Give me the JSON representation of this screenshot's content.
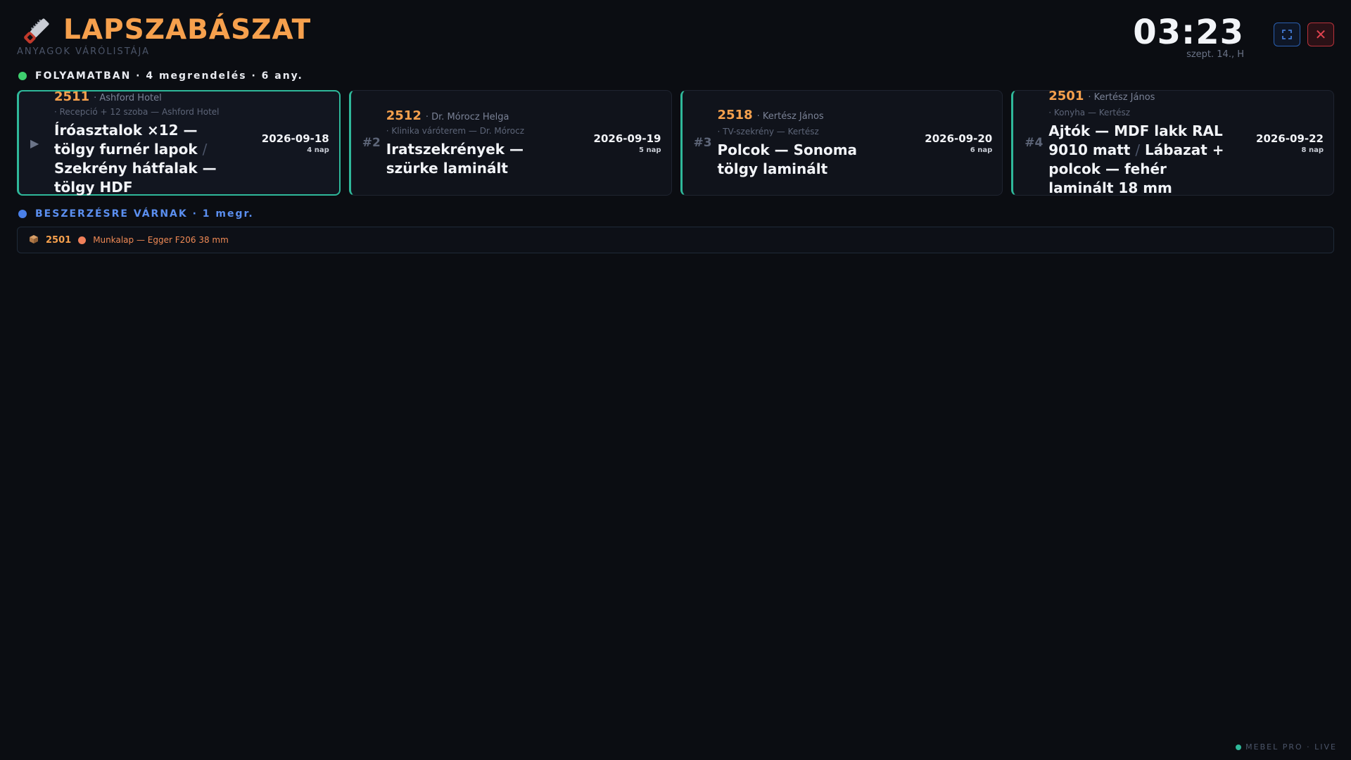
{
  "header": {
    "title": "LAPSZABÁSZAT",
    "subtitle": "ANYAGOK VÁRÓLISTÁJA",
    "clock": "03:23",
    "date": "szept. 14., H",
    "logo_icon": "saw-icon",
    "fullscreen_icon": "fullscreen-icon",
    "close_icon": "close-icon",
    "close_glyph": "✕"
  },
  "in_progress": {
    "label": "FOLYAMATBAN · 4 megrendelés · 6 any.",
    "color": "#3ecf6e",
    "cards": [
      {
        "order_id": "2511",
        "customer": "· Ashford Hotel",
        "detail": "· Recepció + 12 szoba — Ashford Hotel",
        "title_a": "Íróasztalok ×12 — tölgy furnér lapok",
        "title_sep": "/",
        "title_b": "Szekrény hátfalak — tölgy HDF",
        "due_date": "2026-09-18",
        "due_days": "4 nap",
        "marker": "▶"
      },
      {
        "rank": "#2",
        "order_id": "2512",
        "customer": "· Dr. Mórocz Helga",
        "detail": "· Klinika váróterem — Dr. Mórocz",
        "title_a": "Iratszekrények — szürke laminált",
        "due_date": "2026-09-19",
        "due_days": "5 nap"
      },
      {
        "rank": "#3",
        "order_id": "2518",
        "customer": "· Kertész János",
        "detail": "· TV-szekrény — Kertész",
        "title_a": "Polcok — Sonoma tölgy laminált",
        "due_date": "2026-09-20",
        "due_days": "6 nap"
      },
      {
        "rank": "#4",
        "order_id": "2501",
        "customer": "· Kertész János",
        "detail": "· Konyha — Kertész",
        "title_a": "Ajtók — MDF lakk RAL 9010 matt",
        "title_sep": "/",
        "title_b": "Lábazat + polcok — fehér laminált 18 mm",
        "due_date": "2026-09-22",
        "due_days": "8 nap"
      }
    ]
  },
  "awaiting": {
    "label": "BESZERZÉSRE VÁRNAK · 1 megr.",
    "color": "#4a80e8",
    "items": [
      {
        "icon": "box-icon",
        "order_id": "2501",
        "material": "Munkalap — Egger F206 38 mm"
      }
    ]
  },
  "footer": {
    "label": "MEBEL PRO · LIVE"
  }
}
